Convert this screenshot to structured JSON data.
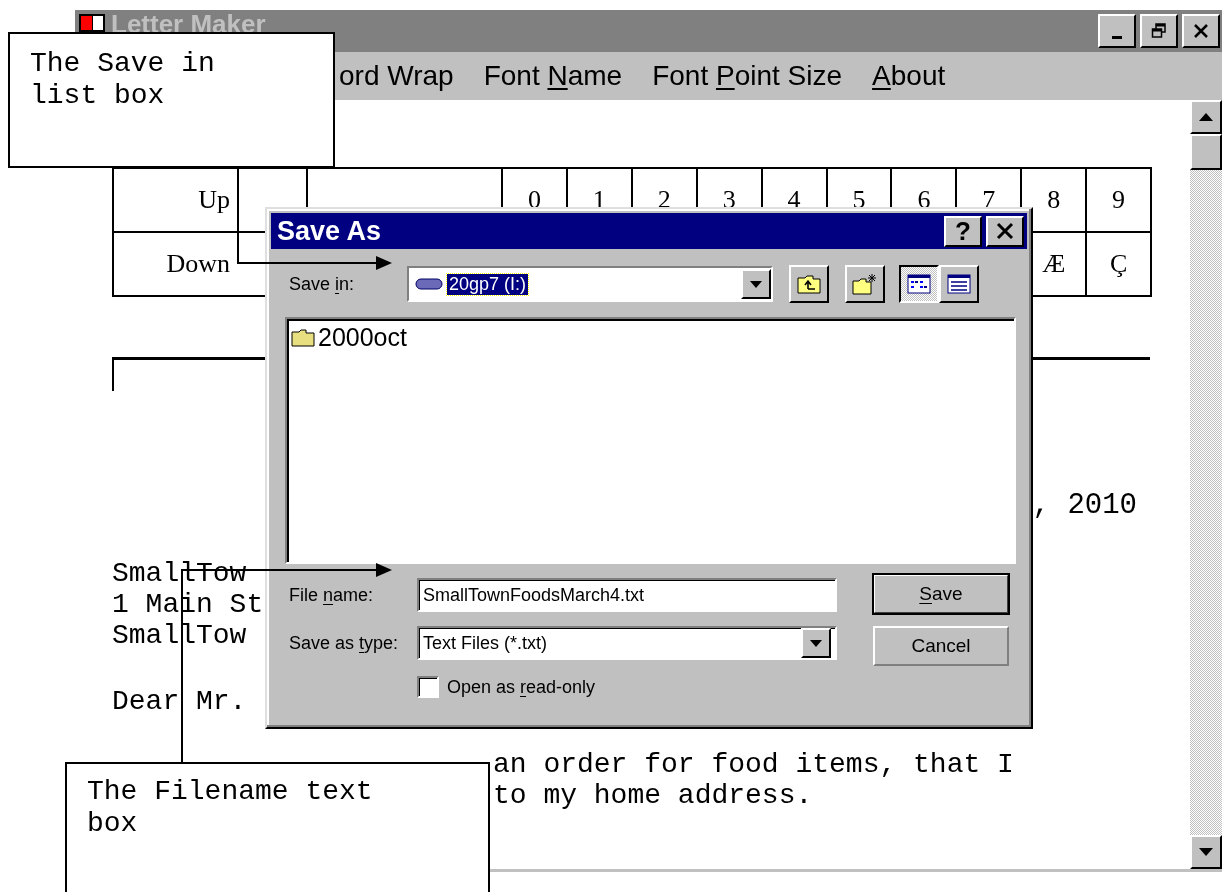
{
  "window": {
    "title": "Letter Maker"
  },
  "menu": [
    {
      "segments": [
        {
          "text": "ord Wrap",
          "underlined": false
        }
      ]
    },
    {
      "segments": [
        {
          "text": "Font ",
          "underlined": false
        },
        {
          "text": "N",
          "underlined": true
        },
        {
          "text": "ame",
          "underlined": false
        }
      ]
    },
    {
      "segments": [
        {
          "text": "Font ",
          "underlined": false
        },
        {
          "text": "P",
          "underlined": true
        },
        {
          "text": "oint Size",
          "underlined": false
        }
      ]
    },
    {
      "segments": [
        {
          "text": "A",
          "underlined": true
        },
        {
          "text": "bout",
          "underlined": false
        }
      ]
    }
  ],
  "keypad": {
    "rows": [
      {
        "label": "Up",
        "keys": [
          "0",
          "1",
          "2",
          "3",
          "4",
          "5",
          "6",
          "7",
          "8",
          "9"
        ]
      },
      {
        "label": "Down",
        "keys": [
          "Æ",
          "Ç"
        ]
      }
    ]
  },
  "letter": {
    "date": ", 2010",
    "address": [
      "SmallTow",
      "1 Main St",
      "SmallTow"
    ],
    "greeting": "Dear Mr.",
    "body": [
      "an order for food items, that I",
      "to my home address."
    ]
  },
  "dialog": {
    "title": "Save As",
    "help": "?",
    "save_in": {
      "segments": [
        {
          "text": "Save ",
          "underlined": false
        },
        {
          "text": "i",
          "underlined": true
        },
        {
          "text": "n:",
          "underlined": false
        }
      ],
      "value": "20gp7 (I:)"
    },
    "view_buttons": [
      {
        "kind": "list",
        "selected": true
      },
      {
        "kind": "details",
        "selected": false
      }
    ],
    "files": [
      {
        "name": "2000oct"
      }
    ],
    "file_name": {
      "segments": [
        {
          "text": "File ",
          "underlined": false
        },
        {
          "text": "n",
          "underlined": true
        },
        {
          "text": "ame:",
          "underlined": false
        }
      ],
      "value": "SmallTownFoodsMarch4.txt"
    },
    "save_as_type": {
      "segments": [
        {
          "text": "Save as ",
          "underlined": false
        },
        {
          "text": "t",
          "underlined": true
        },
        {
          "text": "ype:",
          "underlined": false
        }
      ],
      "value": "Text Files (*.txt)"
    },
    "read_only": {
      "segments": [
        {
          "text": "Open as ",
          "underlined": false
        },
        {
          "text": "r",
          "underlined": true
        },
        {
          "text": "ead-only",
          "underlined": false
        }
      ],
      "checked": false
    },
    "buttons": [
      {
        "segments": [
          {
            "text": "S",
            "underlined": true
          },
          {
            "text": "ave",
            "underlined": false
          }
        ],
        "default": true
      },
      {
        "segments": [
          {
            "text": "Cancel",
            "underlined": false
          }
        ],
        "default": false
      }
    ]
  },
  "callouts": [
    {
      "text": "The Save in list box"
    },
    {
      "text": "The Filename text box"
    }
  ]
}
